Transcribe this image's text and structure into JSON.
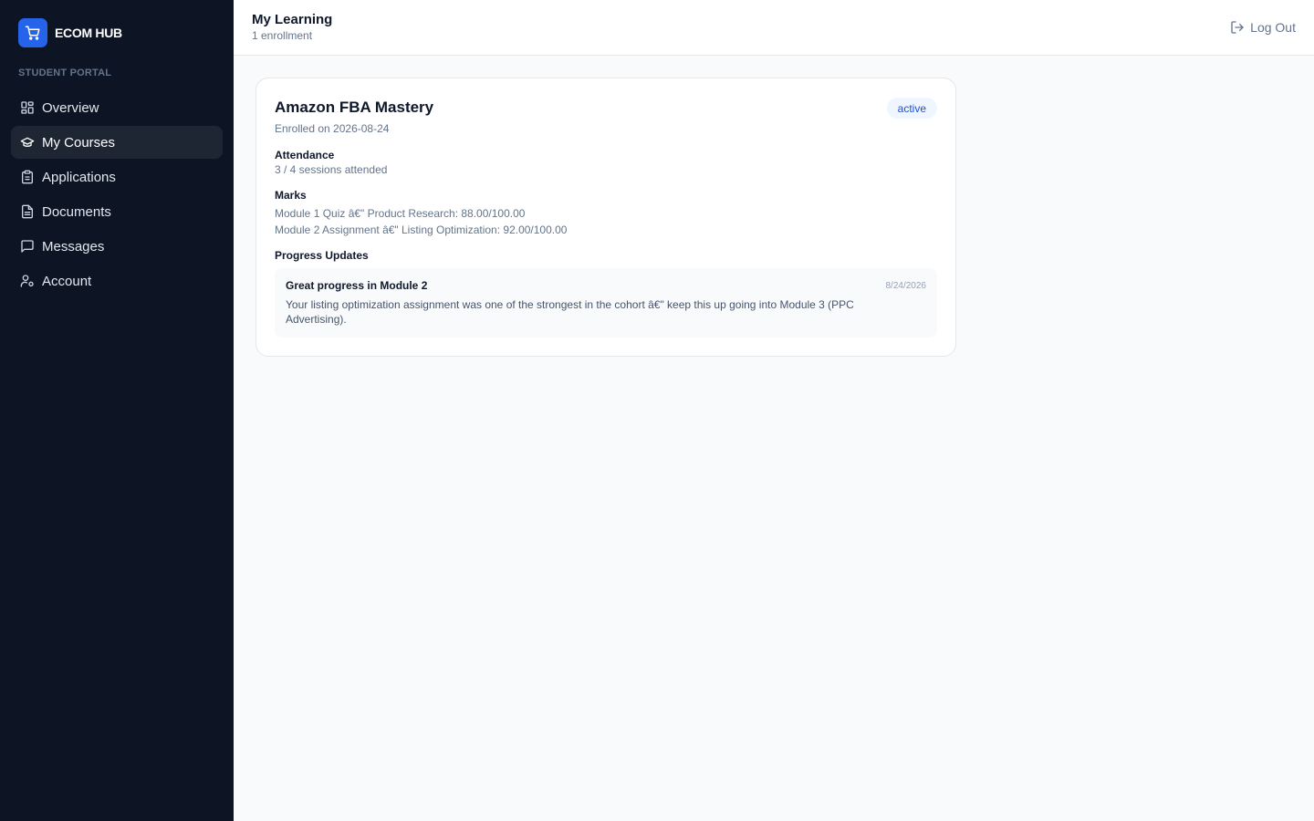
{
  "brand": {
    "name": "ECOM HUB",
    "logo_icon": "shopping-cart-icon",
    "accent": "#2563eb"
  },
  "sidebar": {
    "section_label": "STUDENT PORTAL",
    "items": [
      {
        "label": "Overview",
        "icon": "dashboard-grid-icon",
        "active": false
      },
      {
        "label": "My Courses",
        "icon": "graduation-cap-icon",
        "active": true
      },
      {
        "label": "Applications",
        "icon": "clipboard-icon",
        "active": false
      },
      {
        "label": "Documents",
        "icon": "document-icon",
        "active": false
      },
      {
        "label": "Messages",
        "icon": "message-square-icon",
        "active": false
      },
      {
        "label": "Account",
        "icon": "user-cog-icon",
        "active": false
      }
    ]
  },
  "header": {
    "title": "My Learning",
    "subtitle": "1 enrollment",
    "logout_label": "Log Out",
    "logout_icon": "logout-icon"
  },
  "enrollment": {
    "course_title": "Amazon FBA Mastery",
    "enrolled_text": "Enrolled on 2026-08-24",
    "status": "active",
    "attendance_heading": "Attendance",
    "attendance_text": "3 / 4 sessions attended",
    "marks_heading": "Marks",
    "marks": [
      "Module 1 Quiz â€\" Product Research: 88.00/100.00",
      "Module 2 Assignment â€\" Listing Optimization: 92.00/100.00"
    ],
    "progress_heading": "Progress Updates",
    "updates": [
      {
        "title": "Great progress in Module 2",
        "date": "8/24/2026",
        "body": "Your listing optimization assignment was one of the strongest in the cohort â€\" keep this up going into Module 3 (PPC Advertising)."
      }
    ]
  }
}
